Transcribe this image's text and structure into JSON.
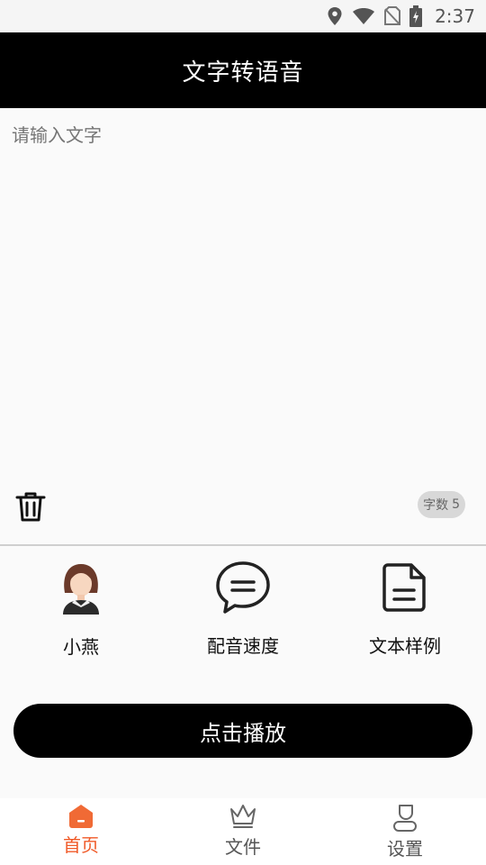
{
  "status_bar": {
    "time": "2:37",
    "icons": [
      "location-icon",
      "wifi-icon",
      "no-sim-icon",
      "battery-charging-icon"
    ]
  },
  "app_bar": {
    "title": "文字转语音"
  },
  "editor": {
    "placeholder": "请输入文字",
    "count_label": "字数",
    "count_value": "5"
  },
  "options": [
    {
      "label": "小燕",
      "icon": "female-avatar-icon"
    },
    {
      "label": "配音速度",
      "icon": "speech-bubble-icon"
    },
    {
      "label": "文本样例",
      "icon": "document-icon"
    }
  ],
  "play_button": {
    "label": "点击播放"
  },
  "bottom_nav": {
    "items": [
      {
        "label": "首页",
        "icon": "home-icon",
        "active": true
      },
      {
        "label": "文件",
        "icon": "crown-icon",
        "active": false
      },
      {
        "label": "设置",
        "icon": "person-icon",
        "active": false
      }
    ],
    "active_color": "#f05a28",
    "inactive_color": "#555555"
  },
  "colors": {
    "app_bar": "#000000",
    "background": "#fafafa",
    "button": "#000000",
    "badge_bg": "#d8d8d8"
  }
}
